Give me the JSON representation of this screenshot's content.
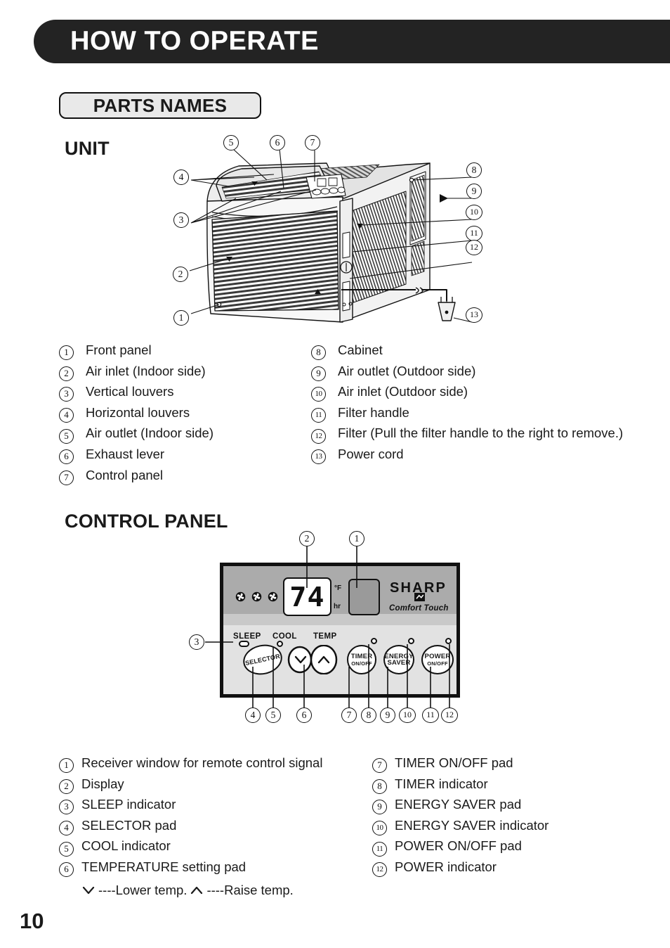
{
  "header": {
    "title": "HOW TO OPERATE"
  },
  "section": {
    "chip_label": "PARTS NAMES"
  },
  "unit": {
    "heading": "UNIT",
    "callouts": [
      "1",
      "2",
      "3",
      "4",
      "5",
      "6",
      "7",
      "8",
      "9",
      "10",
      "11",
      "12",
      "13"
    ],
    "parts_left": [
      {
        "num": "1",
        "label": "Front panel"
      },
      {
        "num": "2",
        "label": "Air inlet  (Indoor side)"
      },
      {
        "num": "3",
        "label": "Vertical louvers"
      },
      {
        "num": "4",
        "label": "Horizontal louvers"
      },
      {
        "num": "5",
        "label": "Air outlet (Indoor side)"
      },
      {
        "num": "6",
        "label": "Exhaust lever"
      },
      {
        "num": "7",
        "label": "Control panel"
      }
    ],
    "parts_right": [
      {
        "num": "8",
        "label": "Cabinet"
      },
      {
        "num": "9",
        "label": "Air outlet (Outdoor side)"
      },
      {
        "num": "10",
        "label": "Air inlet (Outdoor side)"
      },
      {
        "num": "11",
        "label": "Filter handle"
      },
      {
        "num": "12",
        "label": "Filter (Pull  the filter handle to the right to remove.)"
      },
      {
        "num": "13",
        "label": "Power cord"
      }
    ]
  },
  "control_panel": {
    "heading": "CONTROL PANEL",
    "callouts_top": [
      "2",
      "1"
    ],
    "callouts_bottom": [
      "4",
      "5",
      "6",
      "7",
      "8",
      "9",
      "10",
      "11",
      "12"
    ],
    "callout_left": "3",
    "display": {
      "value": "74",
      "unit_temp": "°F",
      "unit_hour": "hr"
    },
    "brand": {
      "logo": "SHARP",
      "tagline": "Comfort Touch"
    },
    "indicator_labels": {
      "sleep": "SLEEP",
      "cool": "COOL",
      "temp": "TEMP"
    },
    "pads": {
      "selector": "SELECTOR",
      "timer_l1": "TIMER",
      "timer_l2": "ON/OFF",
      "energy_l1": "ENERGY",
      "energy_l2": "SAVER",
      "power_l1": "POWER",
      "power_l2": "ON/OFF"
    },
    "parts_left": [
      {
        "num": "1",
        "label": "Receiver window for remote control signal"
      },
      {
        "num": "2",
        "label": "Display"
      },
      {
        "num": "3",
        "label": "SLEEP indicator"
      },
      {
        "num": "4",
        "label": "SELECTOR pad"
      },
      {
        "num": "5",
        "label": "COOL indicator"
      },
      {
        "num": "6",
        "label": "TEMPERATURE setting pad"
      }
    ],
    "parts_left_note": {
      "lower": "----Lower temp.",
      "raise": "----Raise temp."
    },
    "parts_right": [
      {
        "num": "7",
        "label": "TIMER ON/OFF pad"
      },
      {
        "num": "8",
        "label": "TIMER indicator"
      },
      {
        "num": "9",
        "label": "ENERGY SAVER pad"
      },
      {
        "num": "10",
        "label": "ENERGY SAVER indicator"
      },
      {
        "num": "11",
        "label": "POWER ON/OFF pad"
      },
      {
        "num": "12",
        "label": "POWER indicator"
      }
    ]
  },
  "footer": {
    "page_number": "10"
  },
  "colors": {
    "banner": "#232323",
    "chip_fill": "#e9e9e9",
    "panel_top": "#ababab",
    "panel_bottom": "#e2e2e2",
    "ink": "#1a1a1a"
  }
}
